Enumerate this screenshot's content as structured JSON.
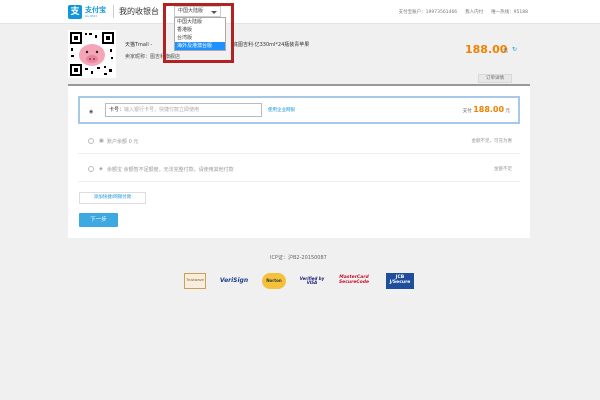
{
  "header": {
    "logo_cn": "支付宝",
    "logo_en": "ALIPAY",
    "title": "我的收银台",
    "region": {
      "selected": "中国大陆版",
      "options": [
        "中国大陆版",
        "香港版",
        "台湾版",
        "海外及港澳台版"
      ],
      "highlighted": "海外及港澳台版"
    },
    "account": "支付宝账户：19973561466",
    "login_link": "我人内付",
    "hotline": "唯一热线：95188"
  },
  "order": {
    "name": "天猫Tmall -",
    "name_after": "底图吉利·亿330ml*24瓶装青苹果",
    "seller": "卖家昵称：图吉利旗舰店",
    "amount": "188.00",
    "amount_unit": "元",
    "detail_tab": "订单详情"
  },
  "payment": {
    "card_input_placeholder": "输入银行卡号，快捷付款立即使用",
    "card_input_prefix": "卡号：",
    "enterprise_link": "使用企业网银",
    "pay_label": "支付",
    "pay_amount": "188.00",
    "pay_unit": "元",
    "balance": {
      "label": "账户余额 0 元",
      "note": "金额不足，可充为惠"
    },
    "yuebao": {
      "label": "余额宝 余额暂不足额度，无法完整付款，请使用其他付款",
      "note": "金额不足"
    },
    "add_card": "添加快捷/网银付款",
    "next": "下一步"
  },
  "footer": {
    "icp": "ICP证：沪B2-20150087",
    "badges": [
      "Trustwave",
      "VeriSign",
      "Norton",
      "Verified by VISA",
      "MasterCard SecureCode",
      "JCB J/Secure"
    ]
  },
  "colors": {
    "accent": "#1296db",
    "amount": "#f08200",
    "highlight_border": "#b22222",
    "selected_option": "#1e90ff"
  }
}
